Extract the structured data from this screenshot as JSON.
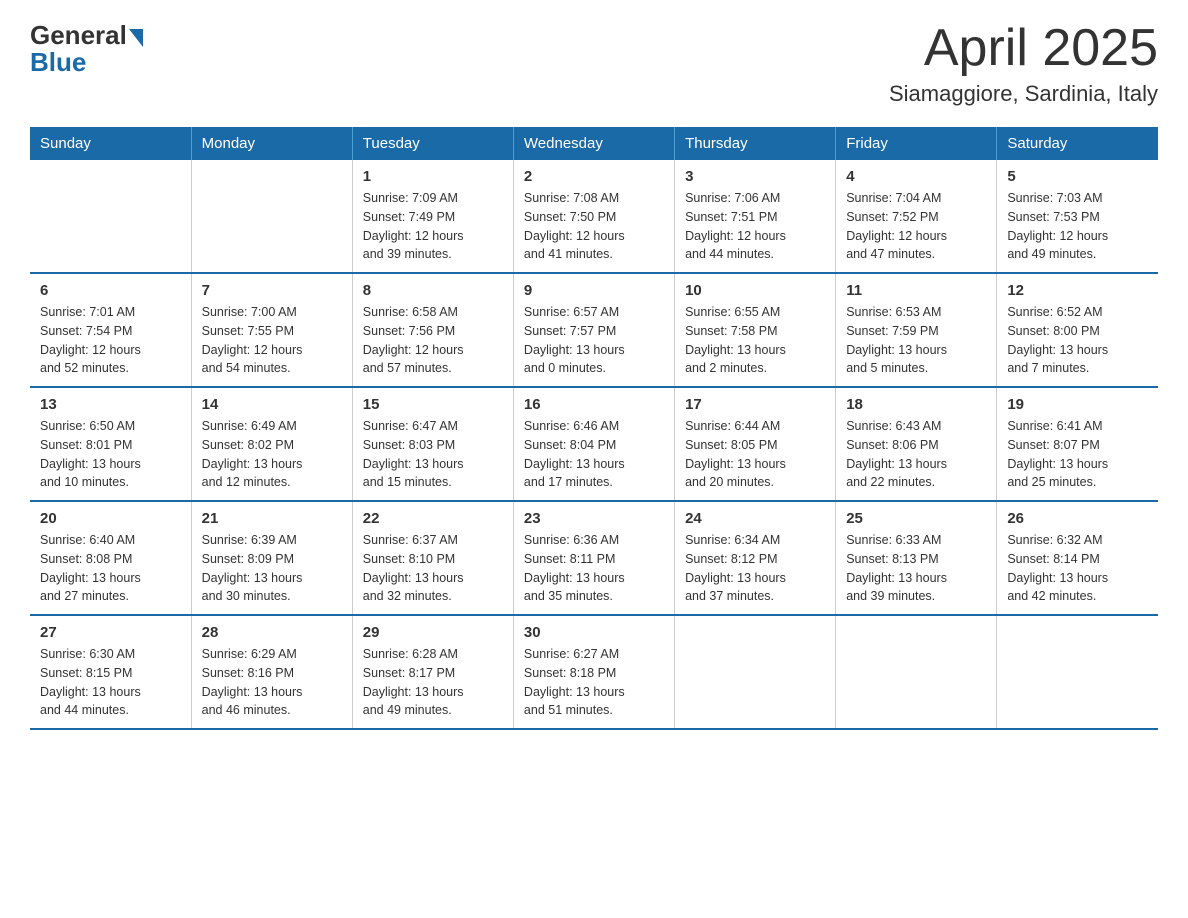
{
  "header": {
    "logo_general": "General",
    "logo_blue": "Blue",
    "main_title": "April 2025",
    "subtitle": "Siamaggiore, Sardinia, Italy"
  },
  "days_of_week": [
    "Sunday",
    "Monday",
    "Tuesday",
    "Wednesday",
    "Thursday",
    "Friday",
    "Saturday"
  ],
  "weeks": [
    [
      {
        "day": "",
        "info": ""
      },
      {
        "day": "",
        "info": ""
      },
      {
        "day": "1",
        "info": "Sunrise: 7:09 AM\nSunset: 7:49 PM\nDaylight: 12 hours\nand 39 minutes."
      },
      {
        "day": "2",
        "info": "Sunrise: 7:08 AM\nSunset: 7:50 PM\nDaylight: 12 hours\nand 41 minutes."
      },
      {
        "day": "3",
        "info": "Sunrise: 7:06 AM\nSunset: 7:51 PM\nDaylight: 12 hours\nand 44 minutes."
      },
      {
        "day": "4",
        "info": "Sunrise: 7:04 AM\nSunset: 7:52 PM\nDaylight: 12 hours\nand 47 minutes."
      },
      {
        "day": "5",
        "info": "Sunrise: 7:03 AM\nSunset: 7:53 PM\nDaylight: 12 hours\nand 49 minutes."
      }
    ],
    [
      {
        "day": "6",
        "info": "Sunrise: 7:01 AM\nSunset: 7:54 PM\nDaylight: 12 hours\nand 52 minutes."
      },
      {
        "day": "7",
        "info": "Sunrise: 7:00 AM\nSunset: 7:55 PM\nDaylight: 12 hours\nand 54 minutes."
      },
      {
        "day": "8",
        "info": "Sunrise: 6:58 AM\nSunset: 7:56 PM\nDaylight: 12 hours\nand 57 minutes."
      },
      {
        "day": "9",
        "info": "Sunrise: 6:57 AM\nSunset: 7:57 PM\nDaylight: 13 hours\nand 0 minutes."
      },
      {
        "day": "10",
        "info": "Sunrise: 6:55 AM\nSunset: 7:58 PM\nDaylight: 13 hours\nand 2 minutes."
      },
      {
        "day": "11",
        "info": "Sunrise: 6:53 AM\nSunset: 7:59 PM\nDaylight: 13 hours\nand 5 minutes."
      },
      {
        "day": "12",
        "info": "Sunrise: 6:52 AM\nSunset: 8:00 PM\nDaylight: 13 hours\nand 7 minutes."
      }
    ],
    [
      {
        "day": "13",
        "info": "Sunrise: 6:50 AM\nSunset: 8:01 PM\nDaylight: 13 hours\nand 10 minutes."
      },
      {
        "day": "14",
        "info": "Sunrise: 6:49 AM\nSunset: 8:02 PM\nDaylight: 13 hours\nand 12 minutes."
      },
      {
        "day": "15",
        "info": "Sunrise: 6:47 AM\nSunset: 8:03 PM\nDaylight: 13 hours\nand 15 minutes."
      },
      {
        "day": "16",
        "info": "Sunrise: 6:46 AM\nSunset: 8:04 PM\nDaylight: 13 hours\nand 17 minutes."
      },
      {
        "day": "17",
        "info": "Sunrise: 6:44 AM\nSunset: 8:05 PM\nDaylight: 13 hours\nand 20 minutes."
      },
      {
        "day": "18",
        "info": "Sunrise: 6:43 AM\nSunset: 8:06 PM\nDaylight: 13 hours\nand 22 minutes."
      },
      {
        "day": "19",
        "info": "Sunrise: 6:41 AM\nSunset: 8:07 PM\nDaylight: 13 hours\nand 25 minutes."
      }
    ],
    [
      {
        "day": "20",
        "info": "Sunrise: 6:40 AM\nSunset: 8:08 PM\nDaylight: 13 hours\nand 27 minutes."
      },
      {
        "day": "21",
        "info": "Sunrise: 6:39 AM\nSunset: 8:09 PM\nDaylight: 13 hours\nand 30 minutes."
      },
      {
        "day": "22",
        "info": "Sunrise: 6:37 AM\nSunset: 8:10 PM\nDaylight: 13 hours\nand 32 minutes."
      },
      {
        "day": "23",
        "info": "Sunrise: 6:36 AM\nSunset: 8:11 PM\nDaylight: 13 hours\nand 35 minutes."
      },
      {
        "day": "24",
        "info": "Sunrise: 6:34 AM\nSunset: 8:12 PM\nDaylight: 13 hours\nand 37 minutes."
      },
      {
        "day": "25",
        "info": "Sunrise: 6:33 AM\nSunset: 8:13 PM\nDaylight: 13 hours\nand 39 minutes."
      },
      {
        "day": "26",
        "info": "Sunrise: 6:32 AM\nSunset: 8:14 PM\nDaylight: 13 hours\nand 42 minutes."
      }
    ],
    [
      {
        "day": "27",
        "info": "Sunrise: 6:30 AM\nSunset: 8:15 PM\nDaylight: 13 hours\nand 44 minutes."
      },
      {
        "day": "28",
        "info": "Sunrise: 6:29 AM\nSunset: 8:16 PM\nDaylight: 13 hours\nand 46 minutes."
      },
      {
        "day": "29",
        "info": "Sunrise: 6:28 AM\nSunset: 8:17 PM\nDaylight: 13 hours\nand 49 minutes."
      },
      {
        "day": "30",
        "info": "Sunrise: 6:27 AM\nSunset: 8:18 PM\nDaylight: 13 hours\nand 51 minutes."
      },
      {
        "day": "",
        "info": ""
      },
      {
        "day": "",
        "info": ""
      },
      {
        "day": "",
        "info": ""
      }
    ]
  ]
}
